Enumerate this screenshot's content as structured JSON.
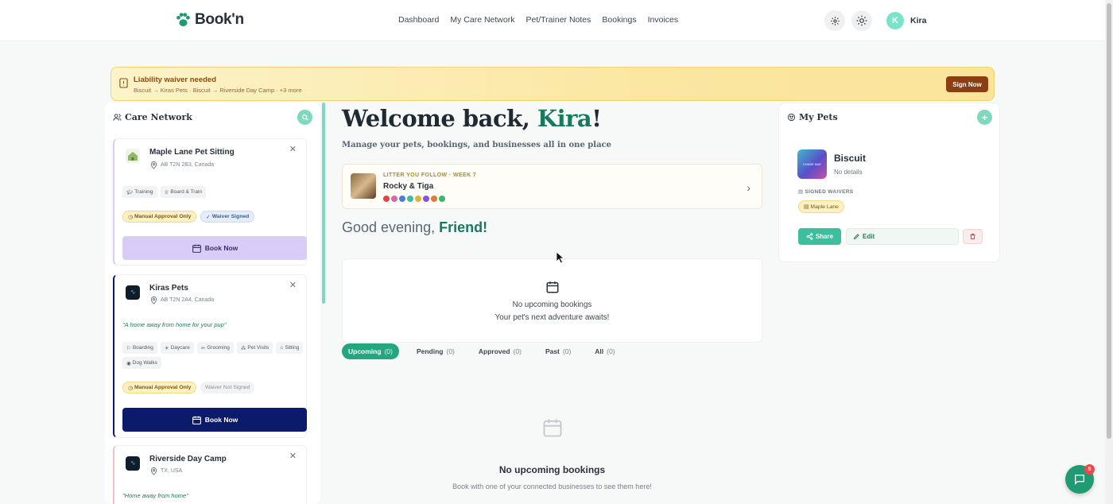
{
  "app": {
    "name": "Book'n"
  },
  "nav": {
    "items": [
      "Dashboard",
      "My Care Network",
      "Pet/Trainer Notes",
      "Bookings",
      "Invoices"
    ]
  },
  "user": {
    "initial": "K",
    "name": "Kira"
  },
  "banner": {
    "title": "Liability waiver needed",
    "subtitle": "Biscuit → Kiras Pets · Biscuit → Riverside Day Camp · +3 more",
    "action": "Sign Now"
  },
  "care_network": {
    "title": "Care Network",
    "businesses": [
      {
        "name": "Maple Lane Pet Sitting",
        "location": "AB T2N 2B3, Canada",
        "services": [
          "Training",
          "Board & Train"
        ],
        "approval": "Manual Approval Only",
        "waiver": "Waiver Signed",
        "book_label": "Book Now"
      },
      {
        "name": "Kiras Pets",
        "location": "AB T2N 2A4, Canada",
        "quote": "\"A home away from home for your pup\"",
        "services": [
          "Boarding",
          "Daycare",
          "Grooming",
          "Pet Visits",
          "Sitting",
          "Dog Walks"
        ],
        "approval": "Manual Approval Only",
        "waiver": "Waiver Not Signed",
        "book_label": "Book Now"
      },
      {
        "name": "Riverside Day Camp",
        "location": "TX, USA",
        "quote": "\"Home away from home\""
      }
    ]
  },
  "main": {
    "welcome_prefix": "Welcome back, ",
    "welcome_name": "Kira",
    "welcome_suffix": "!",
    "subtitle": "Manage your pets, bookings, and businesses all in one place",
    "litter": {
      "label": "LITTER YOU FOLLOW · WEEK 7",
      "name": "Rocky & Tiga",
      "dot_colors": [
        "#e0434a",
        "#d06aa6",
        "#4a7fd6",
        "#3bbf9a",
        "#e0b23a",
        "#8a55d0",
        "#e07a3a",
        "#3ab86a"
      ]
    },
    "greeting_prefix": "Good evening, ",
    "greeting_name": "Friend!",
    "empty_card": {
      "line1": "No upcoming bookings",
      "line2": "Your pet's next adventure awaits!"
    },
    "tabs": [
      {
        "label": "Upcoming",
        "count": "(0)"
      },
      {
        "label": "Pending",
        "count": "(0)"
      },
      {
        "label": "Approved",
        "count": "(0)"
      },
      {
        "label": "Past",
        "count": "(0)"
      },
      {
        "label": "All",
        "count": "(0)"
      }
    ],
    "empty_list": {
      "title": "No upcoming bookings",
      "subtitle": "Book with one of your connected businesses to see them here!"
    }
  },
  "pets": {
    "title": "My Pets",
    "pet": {
      "image_text": "CHASE MAY",
      "name": "Biscuit",
      "details": "No details",
      "waivers_label": "SIGNED WAIVERS",
      "waiver": "Maple Lane",
      "share": "Share",
      "edit": "Edit"
    }
  },
  "chat": {
    "badge": "5"
  },
  "colors": {
    "brand": "#1f9a73",
    "accent_text": "#167a5e",
    "book_primary": "#0b1a6b",
    "book_secondary": "#d9ccf7",
    "banner_button": "#8a3e12"
  }
}
